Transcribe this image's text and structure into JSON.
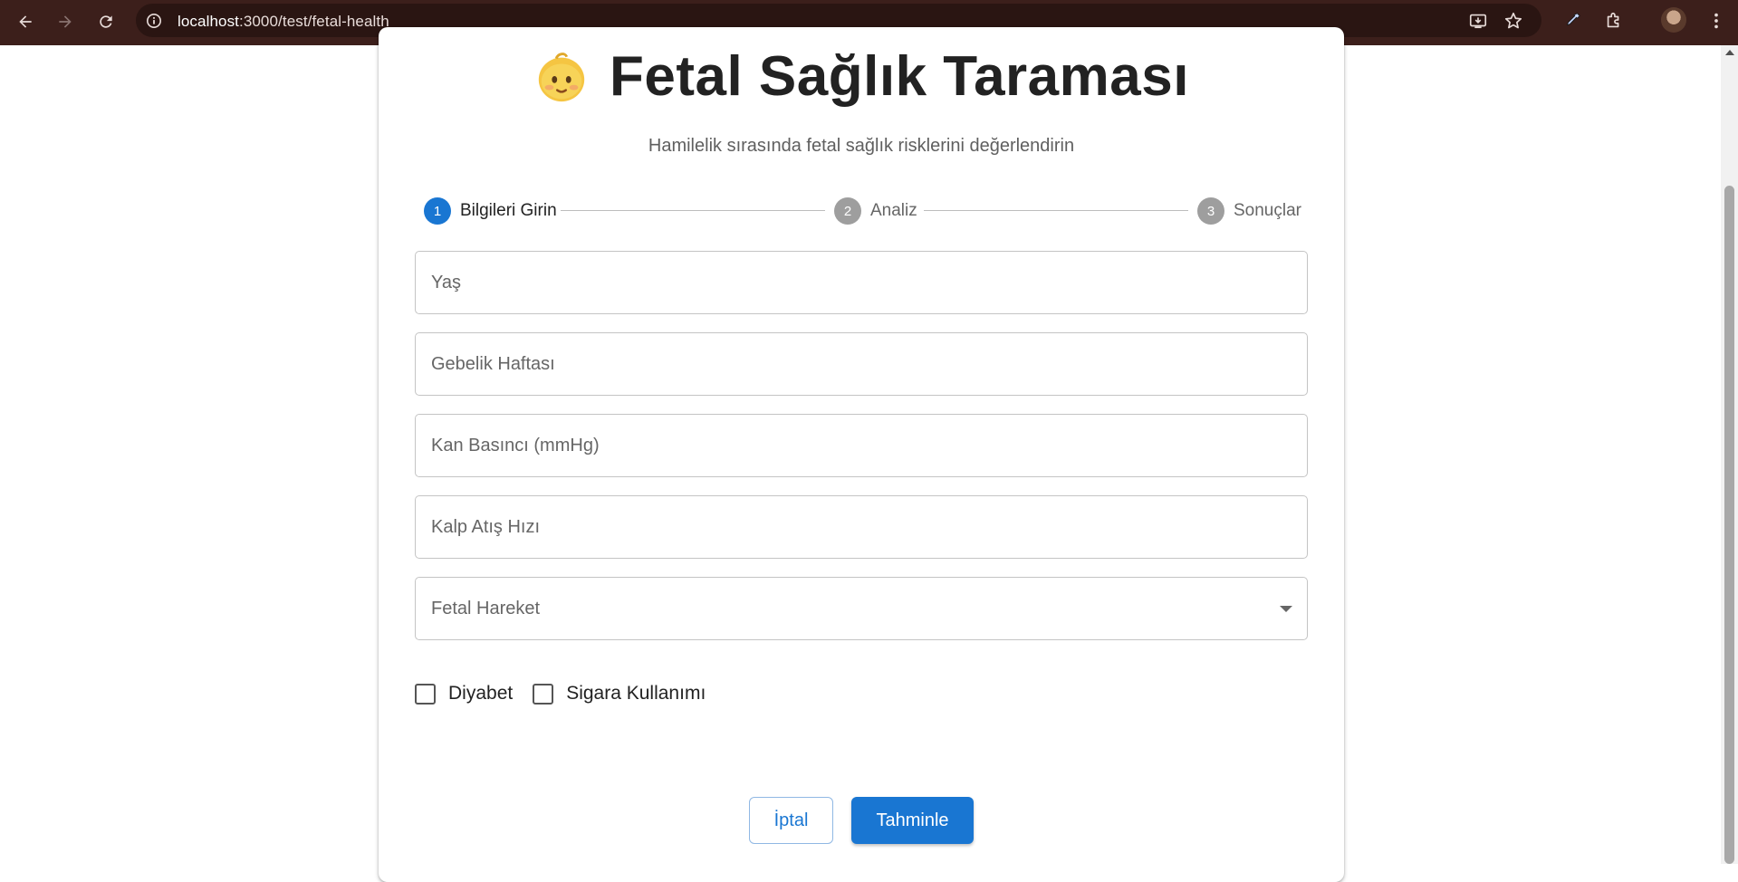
{
  "browser": {
    "url_host": "localhost",
    "url_path": ":3000/test/fetal-health",
    "back_icon": "arrow-left-icon",
    "forward_icon": "arrow-right-icon",
    "reload_icon": "reload-icon",
    "site_info_icon": "info-icon",
    "install_icon": "install-app-icon",
    "bookmark_icon": "star-icon",
    "eyedropper_icon": "eyedropper-icon",
    "extensions_icon": "puzzle-icon",
    "menu_icon": "kebab-menu-icon"
  },
  "header": {
    "emoji": "👶",
    "title": "Fetal Sağlık Taraması",
    "subtitle": "Hamilelik sırasında fetal sağlık risklerini değerlendirin"
  },
  "stepper": {
    "steps": [
      {
        "number": "1",
        "label": "Bilgileri Girin",
        "state": "active"
      },
      {
        "number": "2",
        "label": "Analiz",
        "state": "inactive"
      },
      {
        "number": "3",
        "label": "Sonuçlar",
        "state": "inactive"
      }
    ],
    "active_color": "#1976d2",
    "inactive_color": "#9e9e9e"
  },
  "form": {
    "fields": [
      {
        "label": "Yaş",
        "value": ""
      },
      {
        "label": "Gebelik Haftası",
        "value": ""
      },
      {
        "label": "Kan Basıncı (mmHg)",
        "value": ""
      },
      {
        "label": "Kalp Atış Hızı",
        "value": ""
      },
      {
        "label": "Fetal Hareket",
        "value": "",
        "type": "select"
      }
    ],
    "checkboxes": [
      {
        "label": "Diyabet",
        "checked": false
      },
      {
        "label": "Sigara Kullanımı",
        "checked": false
      }
    ]
  },
  "actions": {
    "cancel_label": "İptal",
    "submit_label": "Tahminle",
    "primary_color": "#1976d2"
  }
}
